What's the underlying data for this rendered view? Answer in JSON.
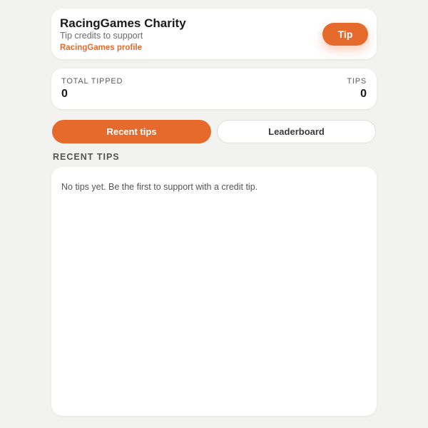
{
  "header": {
    "title": "RacingGames Charity",
    "subtitle": "Tip credits to support",
    "profile_link": "RacingGames profile",
    "tip_button": "Tip"
  },
  "stats": {
    "total_tipped_label": "TOTAL TIPPED",
    "total_tipped_value": "0",
    "tips_label": "TIPS",
    "tips_value": "0"
  },
  "tabs": [
    {
      "label": "Recent tips",
      "active": true
    },
    {
      "label": "Leaderboard",
      "active": false
    }
  ],
  "section": {
    "heading": "RECENT TIPS",
    "empty_message": "No tips yet. Be the first to support with a credit tip."
  },
  "colors": {
    "accent": "#e56a2c",
    "background": "#f2f2f0",
    "card": "#ffffff"
  }
}
